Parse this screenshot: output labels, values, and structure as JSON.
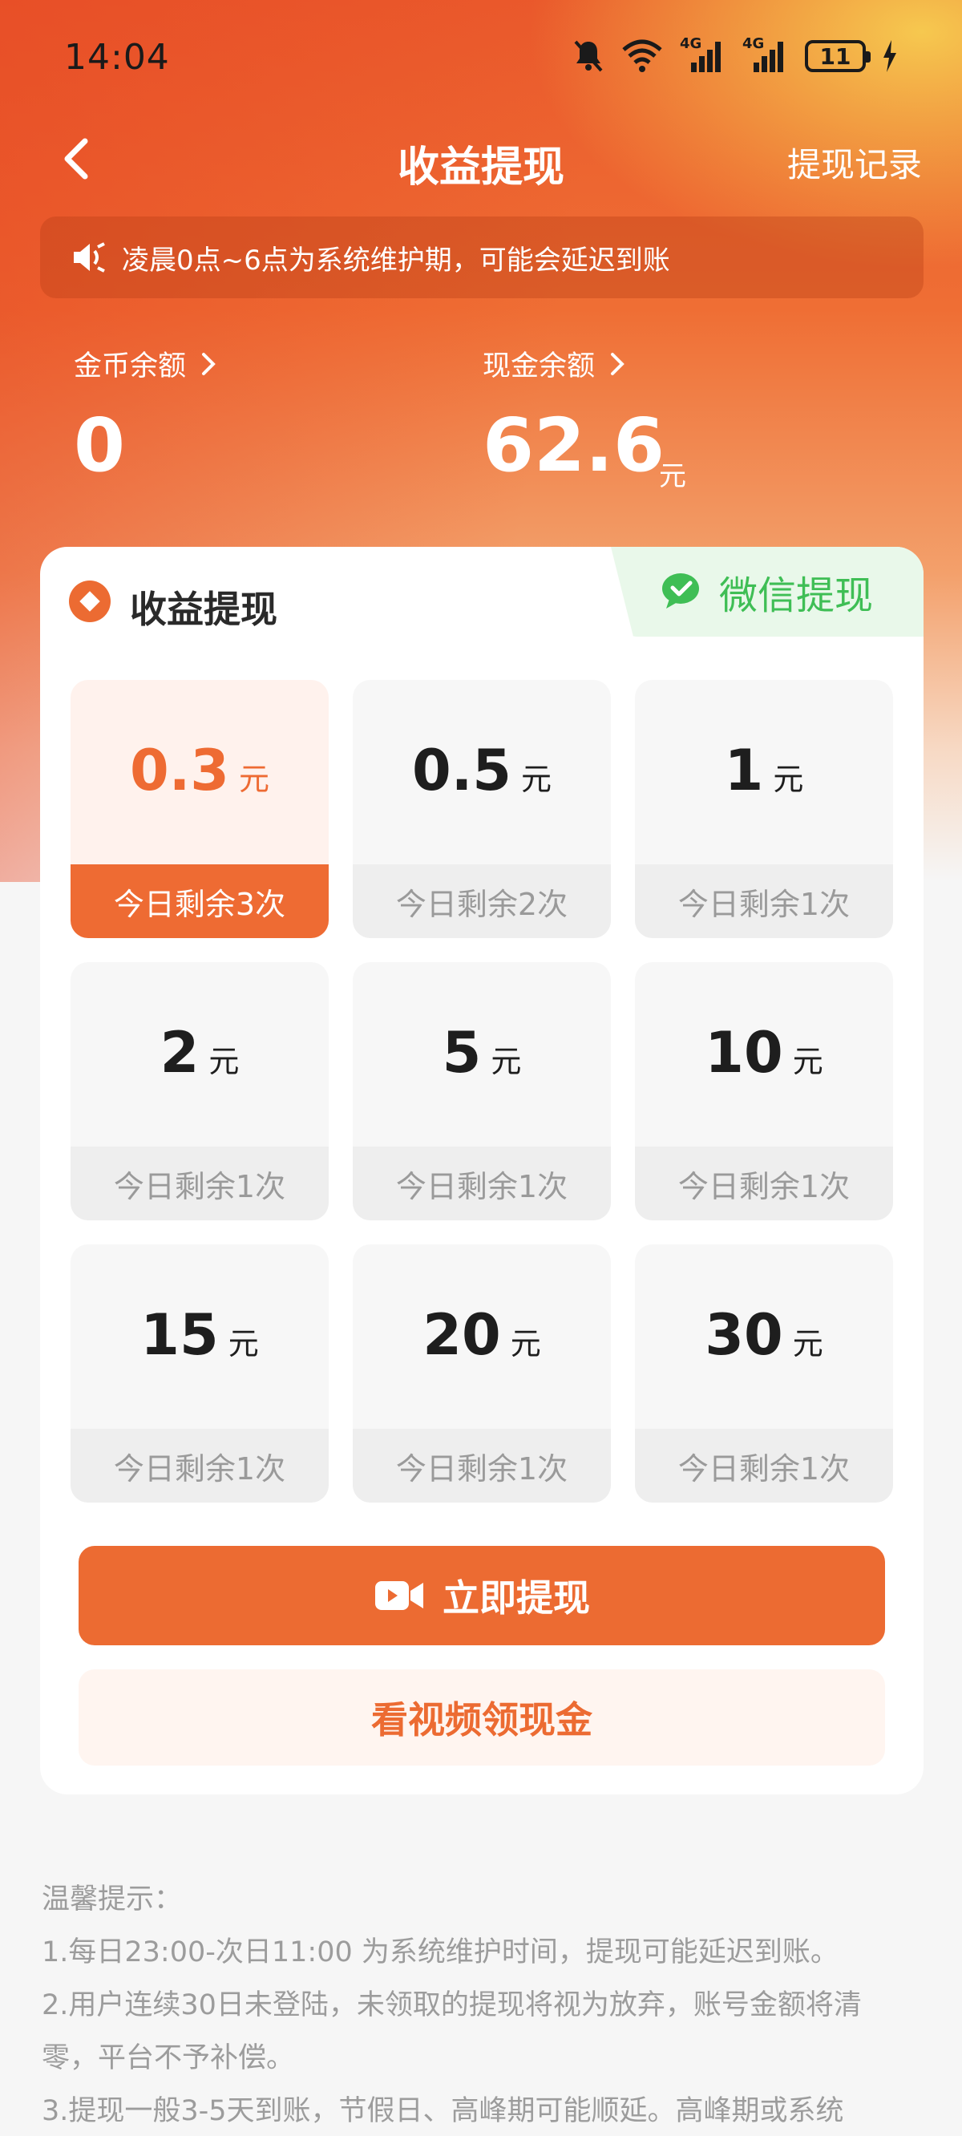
{
  "status_bar": {
    "time": "14:04",
    "battery": "11",
    "signal_1": "4G",
    "signal_2": "4G"
  },
  "nav": {
    "title": "收益提现",
    "record_link": "提现记录"
  },
  "notice": {
    "text": "凌晨0点~6点为系统维护期，可能会延迟到账"
  },
  "balances": {
    "coin": {
      "label": "金币余额",
      "value": "0"
    },
    "cash": {
      "label": "现金余额",
      "value": "62.6",
      "unit": "元"
    }
  },
  "card": {
    "title": "收益提现",
    "method_tab": "微信提现",
    "options": [
      {
        "amount": "0.3",
        "unit": "元",
        "quota": "今日剩余3次",
        "selected": true
      },
      {
        "amount": "0.5",
        "unit": "元",
        "quota": "今日剩余2次"
      },
      {
        "amount": "1",
        "unit": "元",
        "quota": "今日剩余1次"
      },
      {
        "amount": "2",
        "unit": "元",
        "quota": "今日剩余1次"
      },
      {
        "amount": "5",
        "unit": "元",
        "quota": "今日剩余1次"
      },
      {
        "amount": "10",
        "unit": "元",
        "quota": "今日剩余1次"
      },
      {
        "amount": "15",
        "unit": "元",
        "quota": "今日剩余1次"
      },
      {
        "amount": "20",
        "unit": "元",
        "quota": "今日剩余1次"
      },
      {
        "amount": "30",
        "unit": "元",
        "quota": "今日剩余1次"
      }
    ],
    "withdraw_button": "立即提现",
    "video_button": "看视频领现金"
  },
  "tips": {
    "title": "温馨提示：",
    "lines": [
      "1.每日23:00-次日11:00 为系统维护时间，提现可能延迟到账。",
      "2.用户连续30日未登陆，未领取的提现将视为放弃，账号金额将清",
      "零，平台不予补偿。",
      "3.提现一般3-5天到账，节假日、高峰期可能顺延。高峰期或系统"
    ]
  },
  "colors": {
    "accent": "#ec6b32",
    "wechat": "#3fbe55"
  }
}
